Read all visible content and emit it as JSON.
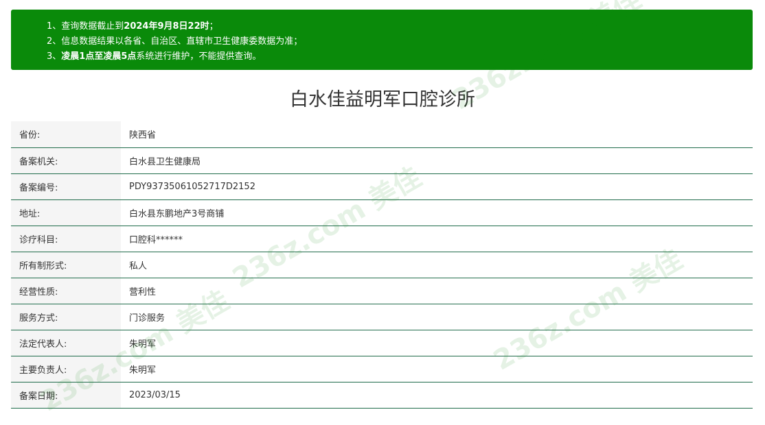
{
  "notice": {
    "line1_prefix": "1、查询数据截止到",
    "line1_bold": "2024年9月8日22时",
    "line1_suffix": "；",
    "line2": "2、信息数据结果以各省、自治区、直辖市卫生健康委数据为准；",
    "line3_prefix": "3、",
    "line3_bold": "凌晨1点至凌晨5点",
    "line3_suffix": "系统进行维护，不能提供查询。"
  },
  "title": "白水佳益明军口腔诊所",
  "rows": [
    {
      "label": "省份:",
      "value": "陕西省"
    },
    {
      "label": "备案机关:",
      "value": "白水县卫生健康局"
    },
    {
      "label": "备案编号:",
      "value": "PDY93735061052717D2152"
    },
    {
      "label": "地址:",
      "value": "白水县东鹏地产3号商铺"
    },
    {
      "label": "诊疗科目:",
      "value": "口腔科******"
    },
    {
      "label": "所有制形式:",
      "value": "私人"
    },
    {
      "label": "经营性质:",
      "value": "营利性"
    },
    {
      "label": "服务方式:",
      "value": "门诊服务"
    },
    {
      "label": "法定代表人:",
      "value": "朱明军"
    },
    {
      "label": "主要负责人:",
      "value": "朱明军"
    },
    {
      "label": "备案日期:",
      "value": "2023/03/15"
    }
  ],
  "watermark_text": "236z.com 美佳",
  "colors": {
    "notice_bg": "#0a8a0a",
    "row_border": "#1f6b4a",
    "label_bg": "#f5f5f5"
  }
}
